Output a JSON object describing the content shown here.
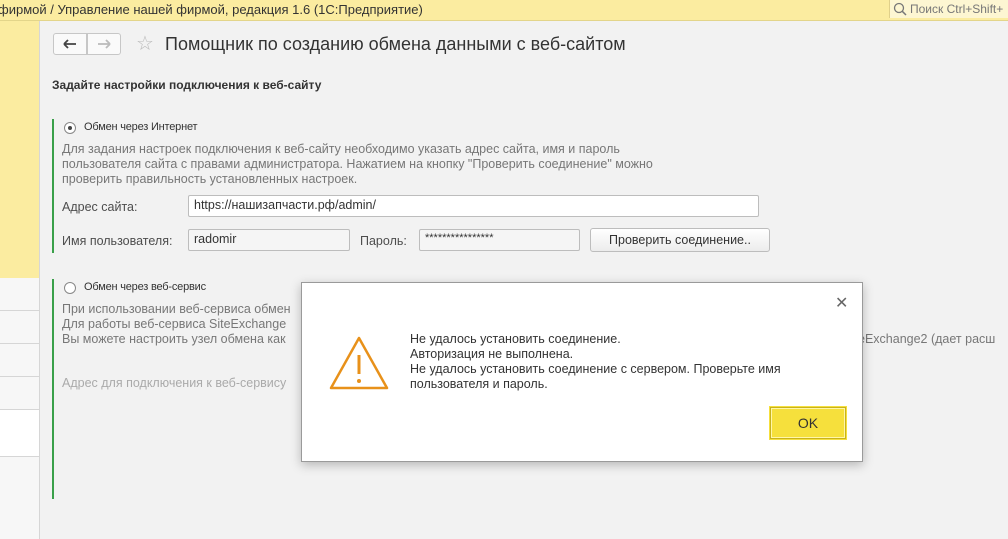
{
  "titlebar": {
    "title": "фирмой / Управление нашей фирмой, редакция 1.6   (1С:Предприятие)",
    "search_placeholder": "Поиск Ctrl+Shift+"
  },
  "toolbar": {
    "back_icon": "arrow-left-icon",
    "forward_icon": "arrow-right-icon",
    "favorite_icon": "star-icon"
  },
  "page": {
    "title": "Помощник по созданию обмена данными с веб-сайтом",
    "section_title": "Задайте настройки подключения к веб-сайту"
  },
  "option_internet": {
    "label": "Обмен через Интернет",
    "selected": true,
    "description": [
      "Для задания настроек подключения к веб-сайту необходимо указать адрес сайта, имя и пароль",
      "пользователя сайта с правами администратора. Нажатием на кнопку \"Проверить соединение\" можно",
      "проверить правильность установленных настроек."
    ],
    "site_label": "Адрес сайта:",
    "site_value": "https://нашизапчасти.рф/admin/",
    "user_label": "Имя пользователя:",
    "user_value": "radomir",
    "password_label": "Пароль:",
    "password_value": "****************",
    "check_button": "Проверить соединение.."
  },
  "option_webservice": {
    "label": "Обмен через веб-сервис",
    "selected": false,
    "description": [
      "При использовании веб-сервиса обмен",
      "Для работы веб-сервиса SiteExchange",
      "Вы можете настроить узел обмена как"
    ],
    "description_tail": "eExchange2 (дает расш",
    "address_label": "Адрес для подключения к веб-сервису"
  },
  "dialog": {
    "close_icon": "close-icon",
    "warning_icon": "warning-icon",
    "lines": [
      "Не удалось установить соединение.",
      "Авторизация не выполнена.",
      "Не удалось установить соединение с сервером. Проверьте имя",
      "пользователя и пароль."
    ],
    "ok_label": "OK"
  },
  "colors": {
    "accent": "#f6e03c",
    "titlebar": "#fbeca0",
    "green_marker": "#3aa04a",
    "warning": "#e8911a"
  }
}
